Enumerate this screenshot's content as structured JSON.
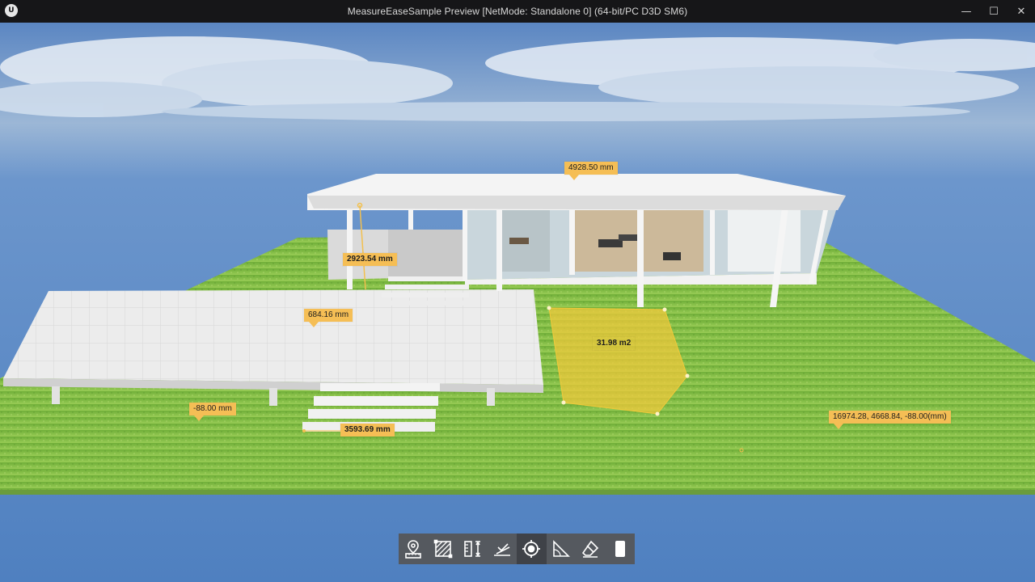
{
  "window": {
    "title": "MeasureEaseSample Preview [NetMode: Standalone 0]  (64-bit/PC D3D SM6)",
    "logo_text": "U",
    "minimize_glyph": "—",
    "maximize_glyph": "☐",
    "close_glyph": "✕"
  },
  "measurements": [
    {
      "id": "roof-length",
      "text": "4928.50 mm"
    },
    {
      "id": "column-height",
      "text": "2923.54 mm"
    },
    {
      "id": "terrace-depth",
      "text": "684.16 mm"
    },
    {
      "id": "area",
      "text": "31.98 m2"
    },
    {
      "id": "ground-offset",
      "text": "-88.00 mm"
    },
    {
      "id": "stairs-width",
      "text": "3593.69 mm"
    },
    {
      "id": "point-coordinates",
      "text": "16974.28, 4668.84, -88.00(mm)"
    }
  ],
  "toolbar": {
    "active_tool": "point-snap",
    "tools": [
      {
        "icon": "location-pin-ruler-icon"
      },
      {
        "icon": "area-hatch-icon"
      },
      {
        "icon": "vertical-measure-icon"
      },
      {
        "icon": "angle-measure-icon"
      },
      {
        "icon": "point-target-icon"
      },
      {
        "icon": "triangle-ruler-icon"
      },
      {
        "icon": "eraser-icon"
      },
      {
        "icon": "clear-all-icon"
      }
    ]
  },
  "colors": {
    "label_bg": "#f5be55",
    "area_fill": "#f2c93a",
    "toolbar_bg": "#55595f",
    "sky": "#5d89c4",
    "grass": "#86c24b"
  }
}
